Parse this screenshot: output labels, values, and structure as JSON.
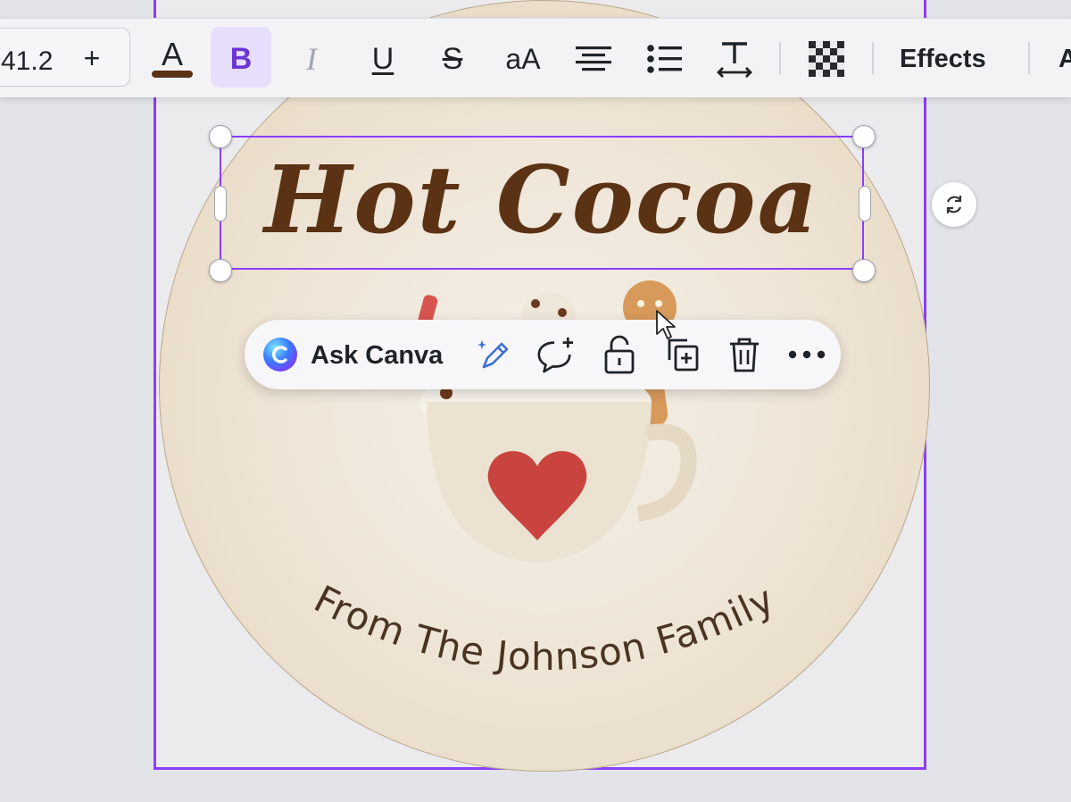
{
  "toolbar": {
    "font_size": "41.2",
    "increase_label": "+",
    "text_color_letter": "A",
    "text_color_swatch": "#5b3214",
    "bold_letter": "B",
    "italic_letter": "I",
    "underline_letter": "U",
    "strike_letter": "S",
    "case_label": "aA",
    "effects_label": "Effects",
    "cut_label": "A"
  },
  "design": {
    "title": "Hot Cocoa",
    "subtitle": "From The Johnson Family"
  },
  "context_menu": {
    "ask_label": "Ask Canva"
  },
  "colors": {
    "selection": "#8b3dff",
    "title_text": "#5b3214",
    "subtitle_text": "#4a3424",
    "bold_active_bg": "#e7defc"
  },
  "icons": {
    "text_color": "text-color-icon",
    "bold": "bold-icon",
    "italic": "italic-icon",
    "underline": "underline-icon",
    "strikethrough": "strikethrough-icon",
    "letter_case": "letter-case-icon",
    "align": "align-center-icon",
    "list": "bullet-list-icon",
    "spacing": "text-spacing-icon",
    "transparency": "transparency-icon",
    "rotate": "rotate-icon",
    "magic_write": "magic-write-icon",
    "comment": "add-comment-icon",
    "lock": "lock-icon",
    "duplicate": "duplicate-icon",
    "delete": "trash-icon",
    "more": "more-icon"
  }
}
